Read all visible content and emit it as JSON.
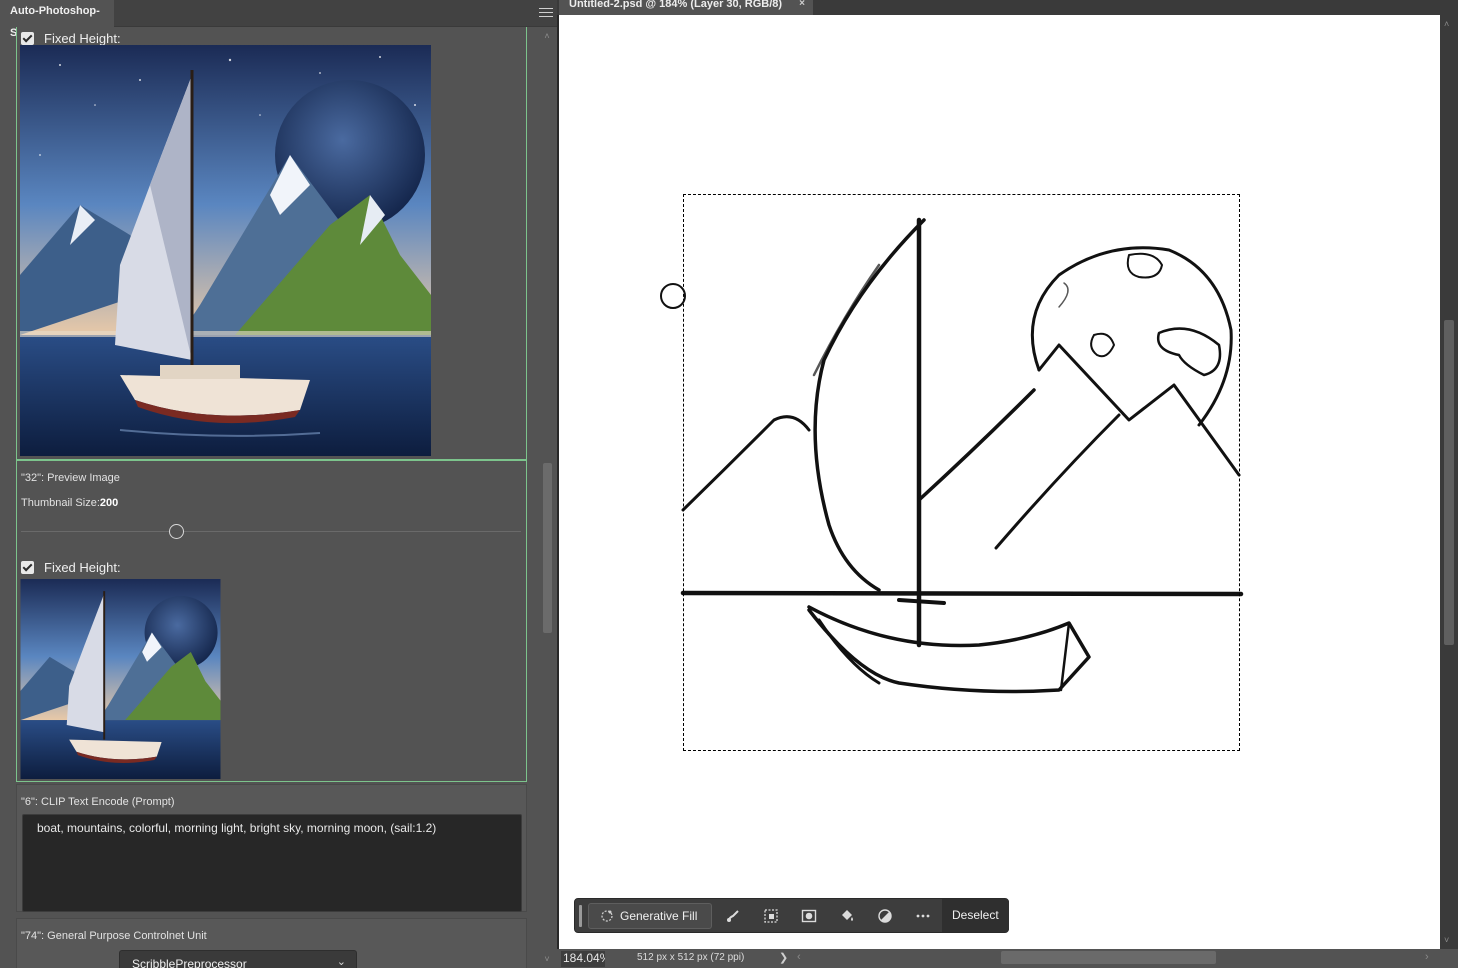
{
  "panel": {
    "tab_label": "Auto-Photoshop-SD",
    "menu_icon": "hamburger-menu-icon",
    "top_node": {
      "fixed_height_label": "Fixed Height:",
      "fixed_height_checked": true,
      "image_alt": "Sailboat under starry sky with moon and mountains"
    },
    "preview_node": {
      "title": "\"32\": Preview Image",
      "thumbnail_size_label": "Thumbnail Size:",
      "thumbnail_size_value": "200",
      "fixed_height_label": "Fixed Height:",
      "fixed_height_checked": true,
      "image_alt": "Sailboat thumbnail"
    },
    "clip_node": {
      "title": "\"6\": CLIP Text Encode (Prompt)",
      "prompt": "boat, mountains, colorful, morning light, bright sky, morning moon, (sail:1.2)"
    },
    "controlnet_node": {
      "title": "\"74\": General Purpose Controlnet Unit",
      "preprocessor": "ScribblePreprocessor"
    }
  },
  "document": {
    "tab_title": "Untitled-2.psd @ 184% (Layer 30, RGB/8)",
    "tab_close": "×",
    "zoom": "184.04%",
    "doc_info": "512 px x 512 px (72 ppi)"
  },
  "taskbar": {
    "generative_fill_label": "Generative Fill",
    "deselect_label": "Deselect",
    "icons": [
      "brush-icon",
      "transform-selection-icon",
      "mask-icon",
      "fill-bucket-icon",
      "adjustment-icon",
      "more-icon"
    ]
  },
  "colors": {
    "panel_bg": "#535353",
    "node_border_active": "#7cc48c",
    "canvas_bg": "#ffffff",
    "workspace_bg": "#282828"
  }
}
